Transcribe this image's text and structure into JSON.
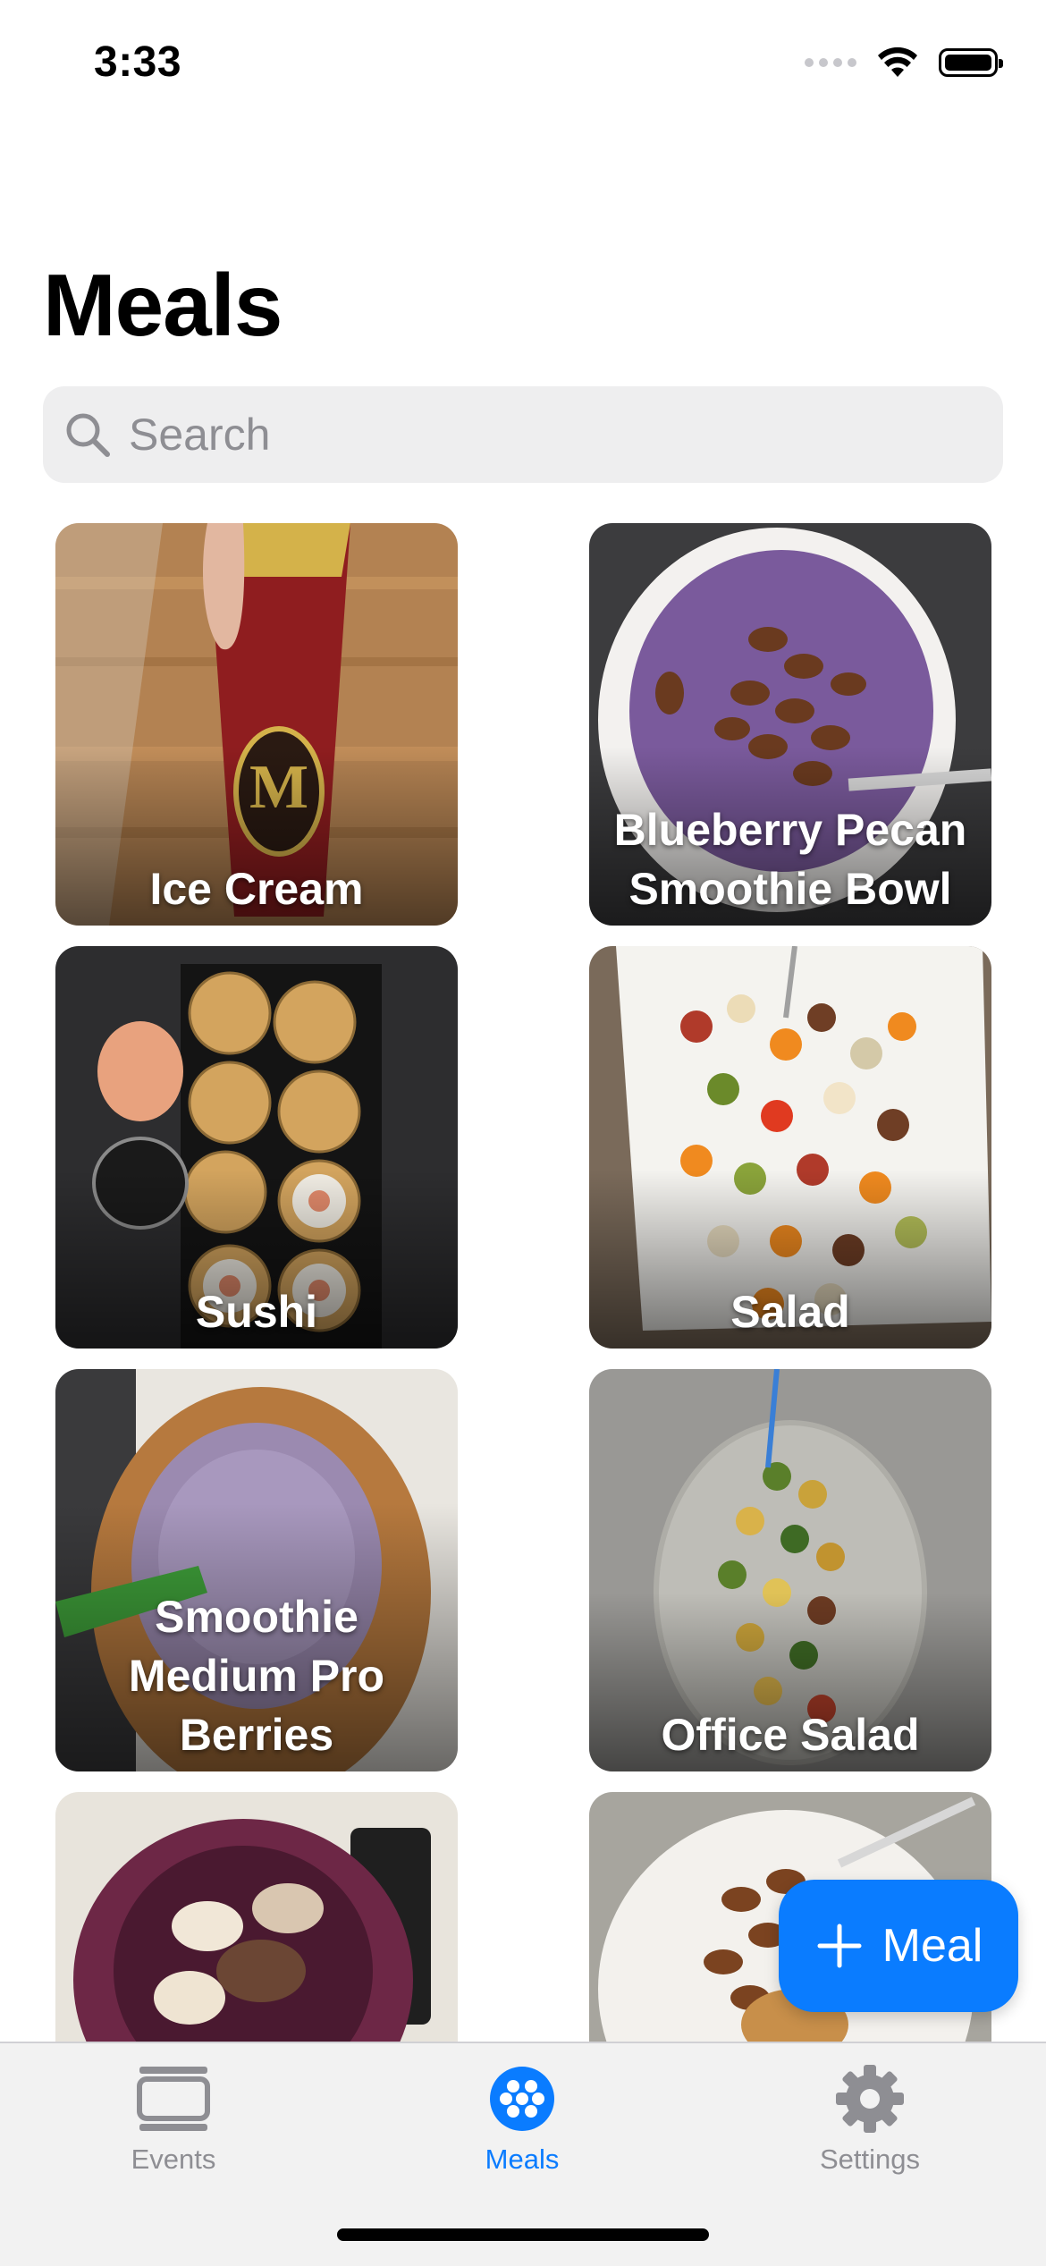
{
  "status_bar": {
    "time": "3:33"
  },
  "header": {
    "title": "Meals"
  },
  "search": {
    "placeholder": "Search",
    "value": ""
  },
  "meals": [
    {
      "name": "Ice Cream"
    },
    {
      "name": "Blueberry Pecan Smoothie Bowl"
    },
    {
      "name": "Sushi"
    },
    {
      "name": "Salad"
    },
    {
      "name": "Smoothie Medium Pro Berries"
    },
    {
      "name": "Office Salad"
    },
    {
      "name": ""
    },
    {
      "name": ""
    }
  ],
  "fab": {
    "label": "Meal",
    "icon": "plus-icon"
  },
  "tab_bar": {
    "tabs": [
      {
        "label": "Events",
        "icon": "events-icon",
        "active": false
      },
      {
        "label": "Meals",
        "icon": "meals-icon",
        "active": true
      },
      {
        "label": "Settings",
        "icon": "gear-icon",
        "active": false
      }
    ]
  },
  "colors": {
    "accent": "#0a7cff",
    "inactive": "#8e8e93",
    "search_bg": "#eeeeef"
  }
}
